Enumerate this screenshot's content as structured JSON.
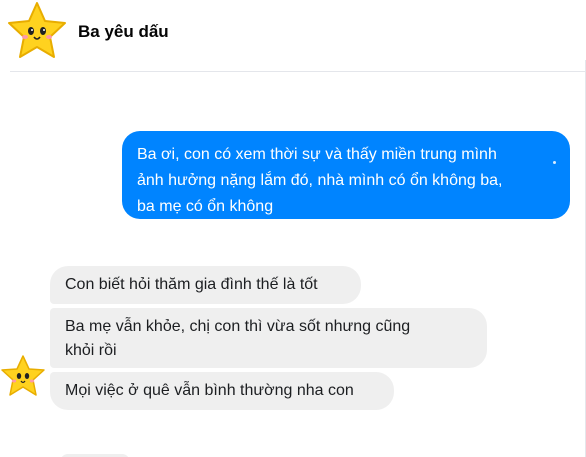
{
  "header": {
    "contact_name": "Ba yêu dấu",
    "avatar_icon": "star-avatar-icon"
  },
  "messages": {
    "outgoing": [
      {
        "lines": [
          "Ba ơi, con có xem thời sự và thấy miền trung mình",
          "ảnh hưởng nặng lắm đó, nhà mình có ổn không ba,",
          "ba mẹ có ổn không"
        ]
      }
    ],
    "incoming": [
      {
        "lines": [
          "Con biết hỏi thăm gia đình thế là tốt"
        ]
      },
      {
        "lines": [
          "Ba mẹ vẫn khỏe, chị con thì vừa sốt nhưng cũng",
          "khỏi rồi"
        ]
      },
      {
        "lines": [
          "Mọi việc ở quê vẫn bình thường nha con"
        ]
      }
    ]
  },
  "colors": {
    "outgoing_bubble": "#0084ff",
    "incoming_bubble": "#efefef",
    "star_fill": "#ffd21f",
    "star_outline": "#e2a800"
  }
}
